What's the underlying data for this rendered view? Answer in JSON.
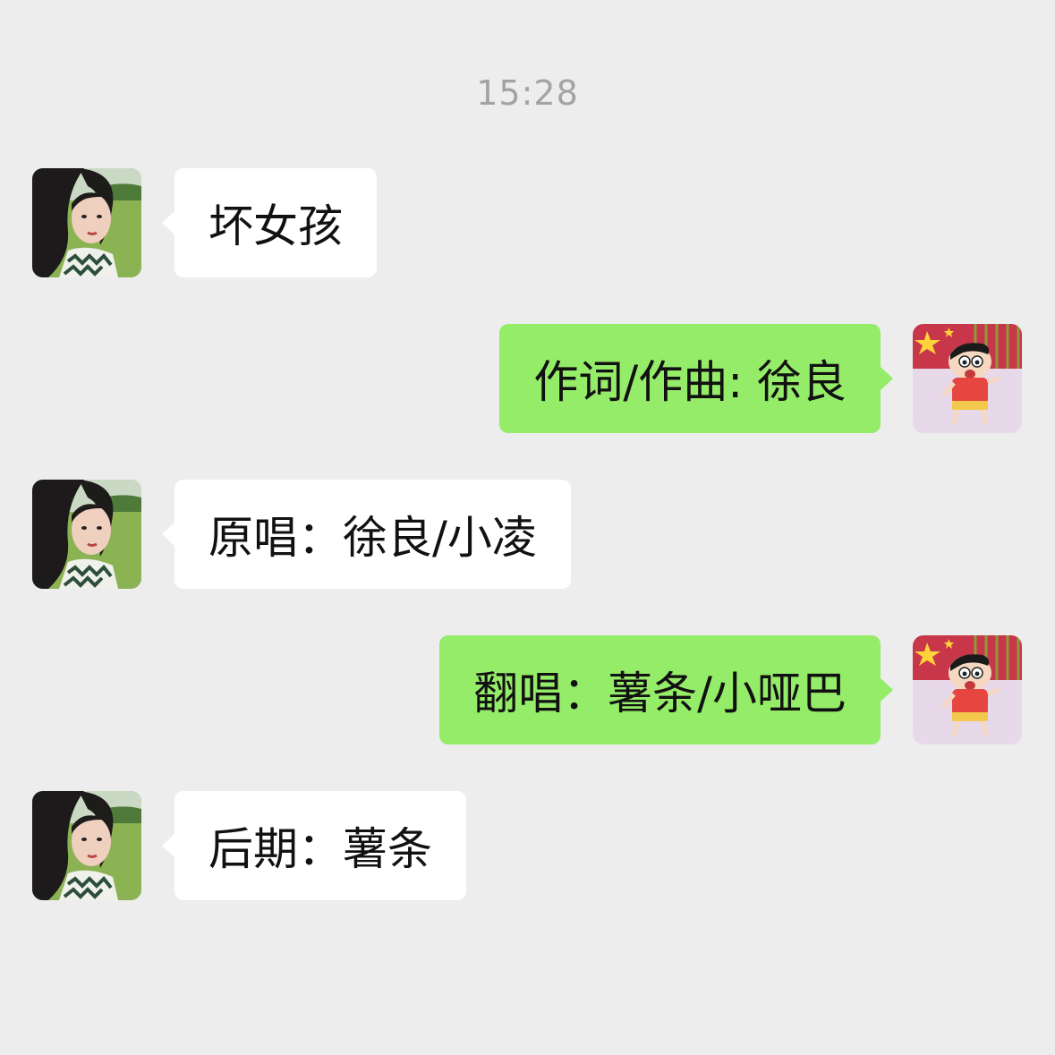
{
  "chat": {
    "timestamp": "15:28",
    "messages": [
      {
        "side": "in",
        "text": "坏女孩",
        "avatar_icon": "girl-photo-avatar"
      },
      {
        "side": "out",
        "text": "作词/作曲: 徐良",
        "avatar_icon": "cartoon-boy-avatar"
      },
      {
        "side": "in",
        "text": "原唱：徐良/小凌",
        "avatar_icon": "girl-photo-avatar"
      },
      {
        "side": "out",
        "text": "翻唱：薯条/小哑巴",
        "avatar_icon": "cartoon-boy-avatar"
      },
      {
        "side": "in",
        "text": "后期：薯条",
        "avatar_icon": "girl-photo-avatar"
      }
    ]
  },
  "colors": {
    "background": "#ededed",
    "incoming_bubble": "#ffffff",
    "outgoing_bubble": "#95ec69",
    "timestamp_text": "#a3a3a3"
  }
}
